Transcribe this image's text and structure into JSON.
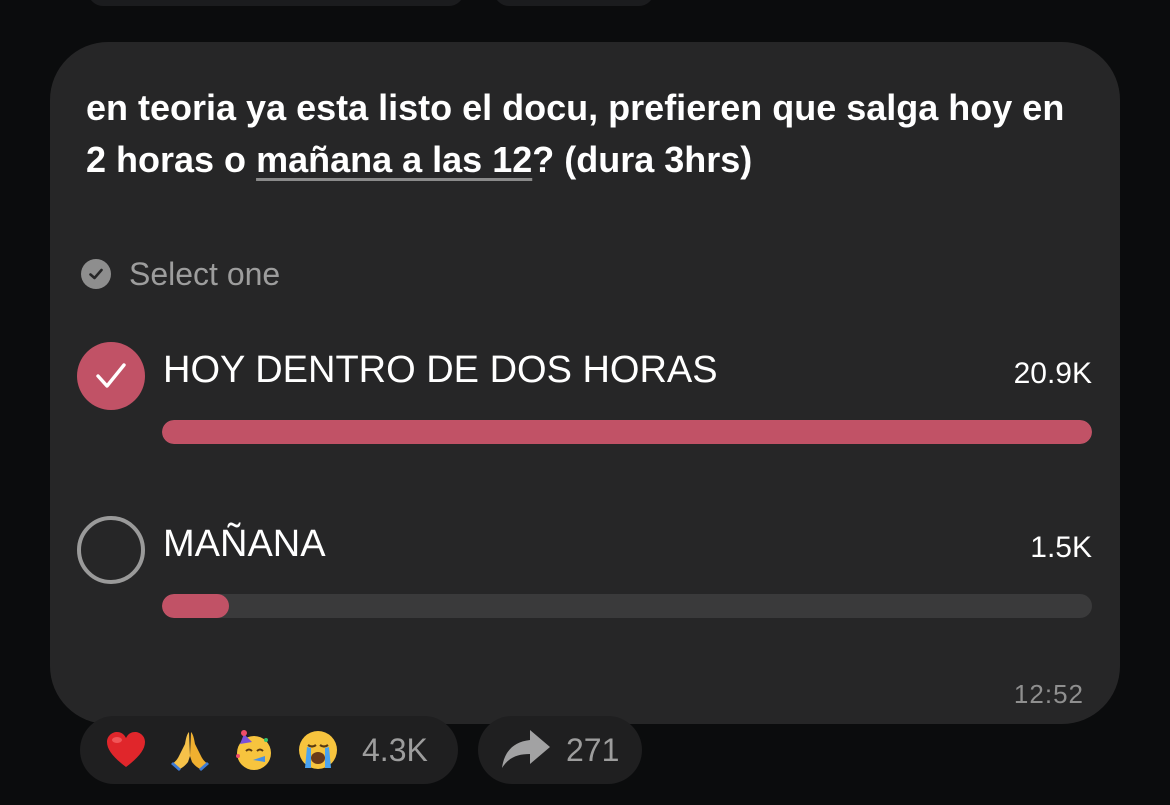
{
  "message": {
    "question_part1": "en teoria ya esta listo el docu, prefieren que salga hoy en 2 horas o ",
    "question_link": "mañana a las 12",
    "question_part2": "? (dura 3hrs)",
    "poll_type": "Select one",
    "options": [
      {
        "label": "HOY DENTRO DE DOS HORAS",
        "count": "20.9K",
        "selected": true,
        "fraction": 1.0
      },
      {
        "label": "MAÑANA",
        "count": "1.5K",
        "selected": false,
        "fraction": 0.072
      }
    ],
    "time": "12:52"
  },
  "reactions": {
    "emojis": [
      "heart-emoji",
      "folded-hands-emoji",
      "partying-face-emoji",
      "crying-face-emoji"
    ],
    "count": "4.3K"
  },
  "forward": {
    "icon": "forward-arrow-icon",
    "count": "271"
  },
  "colors": {
    "accent": "#c15266",
    "bubble": "#262627",
    "background": "#0b0c0d"
  }
}
